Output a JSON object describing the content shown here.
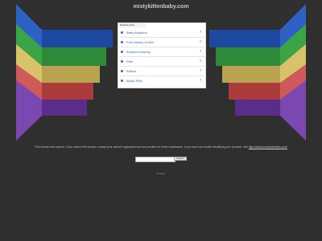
{
  "page": {
    "domain_title": "mistykittenbaby.com"
  },
  "related_links": {
    "header": "Related Links",
    "items": [
      {
        "label": "Baby Adoption"
      },
      {
        "label": "Free Money to Win"
      },
      {
        "label": "Adoption Nearby"
      },
      {
        "label": "Pets"
      },
      {
        "label": "Kittens"
      },
      {
        "label": "Adopt Pets"
      }
    ]
  },
  "notice": {
    "text": "This domain has expired. If you owned this domain, contact your domain registration service provider for further assistance. If you have had trouble identifying your provider, visit",
    "link_text": "http://www.tucowsdomains.com/"
  },
  "search": {
    "input_value": "",
    "button_label": "Search"
  },
  "footer": {
    "privacy_label": "Privacy"
  },
  "colors": {
    "background": "#2f2f2f",
    "link": "#3a66b0",
    "wing_blue": "#2a5fbf",
    "wing_green": "#2f9a3a",
    "wing_yellow": "#c7b257",
    "wing_red": "#c45050",
    "wing_purple": "#6a3aa0"
  }
}
